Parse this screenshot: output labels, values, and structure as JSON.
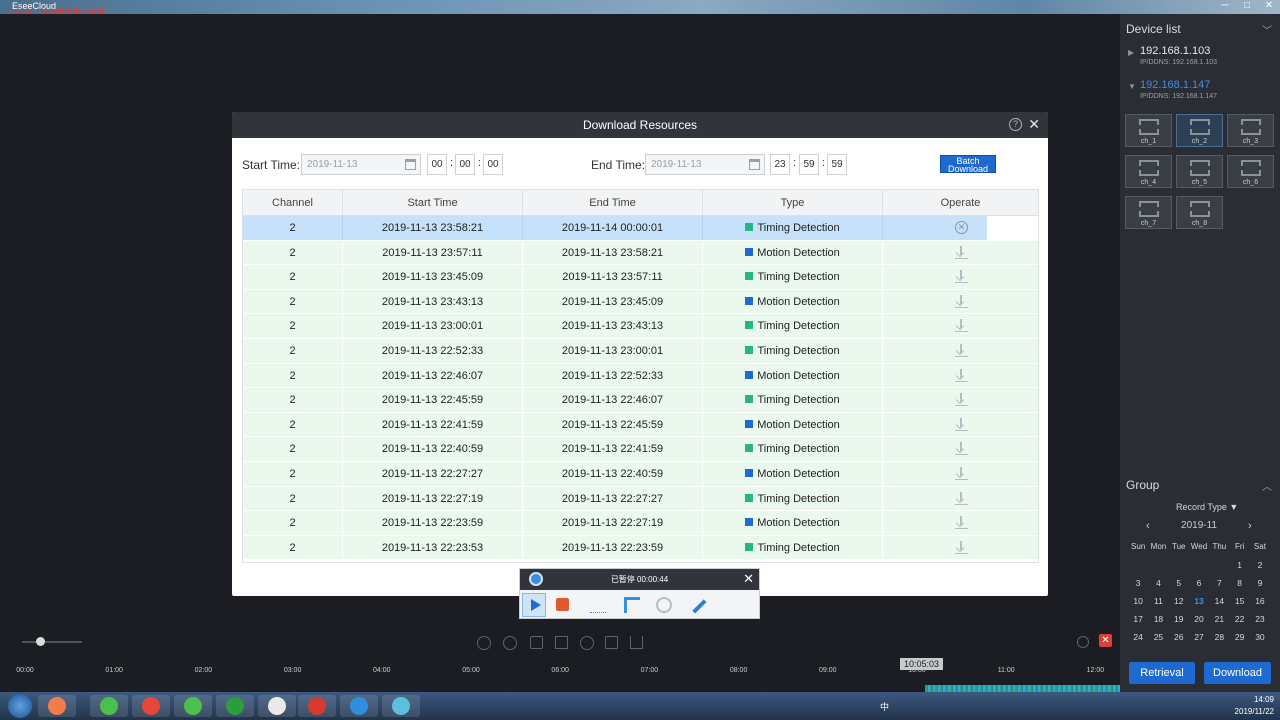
{
  "app": {
    "title": "EseeCloud",
    "subtitle": "支持多... 快速批量用户管理"
  },
  "window_controls": [
    "─",
    "□",
    "✕"
  ],
  "device_list": {
    "title": "Device list",
    "devices": [
      {
        "ip": "192.168.1.103",
        "ddns": "IP/DDNS: 192.168.1.103",
        "selected": false
      },
      {
        "ip": "192.168.1.147",
        "ddns": "IP/DDNS: 192.168.1.147",
        "selected": true
      }
    ],
    "channels": [
      "ch_1",
      "ch_2",
      "ch_3",
      "ch_4",
      "ch_5",
      "ch_6",
      "ch_7",
      "ch_8"
    ]
  },
  "group": {
    "title": "Group",
    "record_type_label": "Record Type",
    "month": "2019-11",
    "weekdays": [
      "Sun",
      "Mon",
      "Tue",
      "Wed",
      "Thu",
      "Fri",
      "Sat"
    ],
    "days": [
      "",
      "",
      "",
      "",
      "",
      "1",
      "2",
      "3",
      "4",
      "5",
      "6",
      "7",
      "8",
      "9",
      "10",
      "11",
      "12",
      "13",
      "14",
      "15",
      "16",
      "17",
      "18",
      "19",
      "20",
      "21",
      "22",
      "23",
      "24",
      "25",
      "26",
      "27",
      "28",
      "29",
      "30"
    ],
    "today": "13"
  },
  "buttons": {
    "retrieval": "Retrieval",
    "download": "Download"
  },
  "timeline": {
    "current_time": "10:05:03",
    "ticks": [
      "00:00",
      "01:00",
      "02:00",
      "03:00",
      "04:00",
      "05:00",
      "06:00",
      "07:00",
      "08:00",
      "09:00",
      "10:00",
      "11:00",
      "12:00"
    ]
  },
  "modal": {
    "title": "Download Resources",
    "start_label": "Start Time:",
    "start_date": "2019-11-13",
    "start_h": "00",
    "start_m": "00",
    "start_s": "00",
    "end_label": "End Time:",
    "end_date": "2019-11-13",
    "end_h": "23",
    "end_m": "59",
    "end_s": "59",
    "batch_line1": "Batch",
    "batch_line2": "Download",
    "columns": [
      "Channel",
      "Start Time",
      "End Time",
      "Type",
      "Operate"
    ],
    "type_colors": {
      "Timing Detection": "#27b585",
      "Motion Detection": "#1f6ad0"
    },
    "rows": [
      {
        "channel": "2",
        "start": "2019-11-13 23:58:21",
        "end": "2019-11-14 00:00:01",
        "type": "Timing Detection",
        "op": "cancel"
      },
      {
        "channel": "2",
        "start": "2019-11-13 23:57:11",
        "end": "2019-11-13 23:58:21",
        "type": "Motion Detection",
        "op": "download"
      },
      {
        "channel": "2",
        "start": "2019-11-13 23:45:09",
        "end": "2019-11-13 23:57:11",
        "type": "Timing Detection",
        "op": "download"
      },
      {
        "channel": "2",
        "start": "2019-11-13 23:43:13",
        "end": "2019-11-13 23:45:09",
        "type": "Motion Detection",
        "op": "download"
      },
      {
        "channel": "2",
        "start": "2019-11-13 23:00:01",
        "end": "2019-11-13 23:43:13",
        "type": "Timing Detection",
        "op": "download"
      },
      {
        "channel": "2",
        "start": "2019-11-13 22:52:33",
        "end": "2019-11-13 23:00:01",
        "type": "Timing Detection",
        "op": "download"
      },
      {
        "channel": "2",
        "start": "2019-11-13 22:46:07",
        "end": "2019-11-13 22:52:33",
        "type": "Motion Detection",
        "op": "download"
      },
      {
        "channel": "2",
        "start": "2019-11-13 22:45:59",
        "end": "2019-11-13 22:46:07",
        "type": "Timing Detection",
        "op": "download"
      },
      {
        "channel": "2",
        "start": "2019-11-13 22:41:59",
        "end": "2019-11-13 22:45:59",
        "type": "Motion Detection",
        "op": "download"
      },
      {
        "channel": "2",
        "start": "2019-11-13 22:40:59",
        "end": "2019-11-13 22:41:59",
        "type": "Timing Detection",
        "op": "download"
      },
      {
        "channel": "2",
        "start": "2019-11-13 22:27:27",
        "end": "2019-11-13 22:40:59",
        "type": "Motion Detection",
        "op": "download"
      },
      {
        "channel": "2",
        "start": "2019-11-13 22:27:19",
        "end": "2019-11-13 22:27:27",
        "type": "Timing Detection",
        "op": "download"
      },
      {
        "channel": "2",
        "start": "2019-11-13 22:23:59",
        "end": "2019-11-13 22:27:19",
        "type": "Motion Detection",
        "op": "download"
      },
      {
        "channel": "2",
        "start": "2019-11-13 22:23:53",
        "end": "2019-11-13 22:23:59",
        "type": "Timing Detection",
        "op": "download"
      }
    ]
  },
  "recorder": {
    "status": "已暂停 00:00:44"
  },
  "taskbar": {
    "time": "14:09",
    "date": "2019/11/22",
    "ime": "中"
  }
}
